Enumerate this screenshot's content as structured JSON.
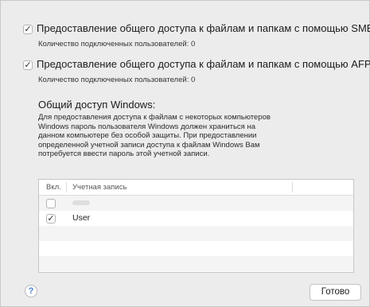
{
  "options": {
    "smb": {
      "label": "Предоставление общего доступа к файлам и папкам с помощью SMB",
      "checked": true,
      "check_glyph": "✓",
      "connected_users": "Количество подключенных пользователей: 0"
    },
    "afp": {
      "label": "Предоставление общего доступа к файлам и папкам с помощью AFP",
      "checked": true,
      "check_glyph": "✓",
      "connected_users": "Количество подключенных пользователей: 0"
    }
  },
  "windows_sharing": {
    "title": "Общий доступ Windows:",
    "description": "Для предоставления доступа к файлам с некоторых компьютеров Windows пароль пользователя Windows должен храниться на данном компьютере без особой защиты. При предоставлении определенной учетной записи доступа к файлам Windows Вам потребуется ввести пароль этой учетной записи."
  },
  "accounts_table": {
    "columns": [
      "Вкл.",
      "Учетная запись"
    ],
    "rows": [
      {
        "enabled": false,
        "check_glyph": "",
        "account": ""
      },
      {
        "enabled": true,
        "check_glyph": "✓",
        "account": "User"
      }
    ]
  },
  "footer": {
    "help_glyph": "?",
    "done_label": "Готово"
  },
  "icons": {
    "help": "help-icon",
    "check": "checkmark-icon"
  }
}
